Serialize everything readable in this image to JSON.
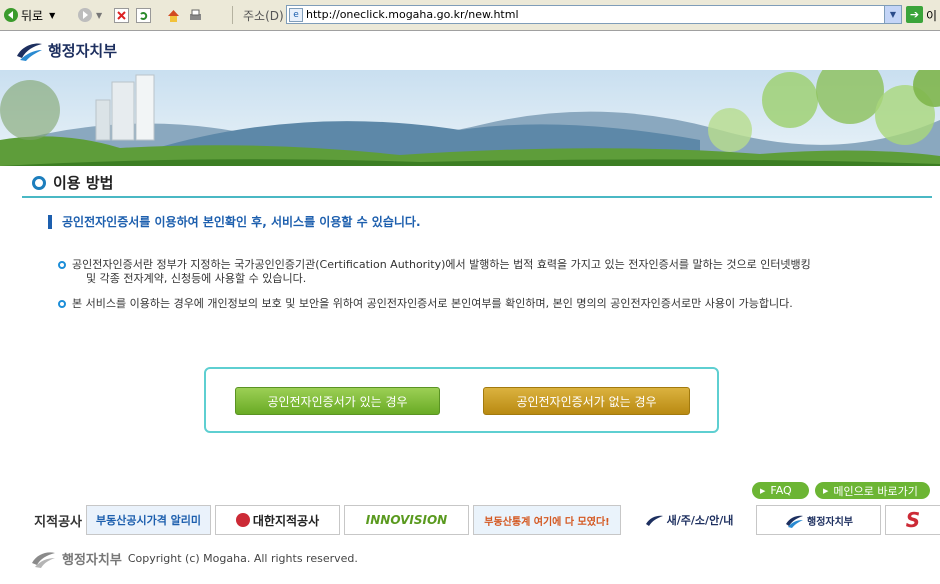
{
  "browser": {
    "back_label": "뒤로",
    "address_label": "주소(D)",
    "url": "http://oneclick.mogaha.go.kr/new.html",
    "go_label": "이"
  },
  "logo": {
    "text": "행정자치부"
  },
  "section": {
    "title": "이용 방법"
  },
  "headline": "공인전자인증서를 이용하여 본인확인 후, 서비스를 이용할 수 있습니다.",
  "bullets": [
    {
      "line1": "공인전자인증서란 정부가 지정하는 국가공인인증기관(Certification Authority)에서 발행하는 법적 효력을 가지고 있는 전자인증서를 말하는 것으로 인터넷뱅킹",
      "line2": "및 각종 전자계약, 신청등에 사용할 수 있습니다."
    },
    {
      "line1": "본 서비스를 이용하는 경우에 개인정보의 보호 및 보안을 위하여 공인전자인증서로 본인여부를 확인하며, 본인 명의의 공인전자인증서로만 사용이 가능합니다.",
      "line2": ""
    }
  ],
  "buttons": {
    "with_cert": "공인전자인증서가 있는 경우",
    "without_cert": "공인전자인증서가 없는 경우"
  },
  "links": {
    "faq": "FAQ",
    "main": "메인으로 바로가기"
  },
  "partners": [
    {
      "name": "지적공사",
      "color": "#333333"
    },
    {
      "name": "부동산공시가격 알리미",
      "color": "#1d5fae"
    },
    {
      "name": "대한지적공사",
      "color": "#222222"
    },
    {
      "name": "INNOVISION",
      "color": "#5a9a1f"
    },
    {
      "name": "부동산통계 여기에 다 모였다!",
      "color": "#d4571f"
    },
    {
      "name": "새/주/소/안/내",
      "color": "#1d2f5f"
    },
    {
      "name": "행정자치부",
      "color": "#1d2f5f"
    },
    {
      "name": "S",
      "color": "#cc2a36"
    }
  ],
  "footer": {
    "logo_text": "행정자치부",
    "copyright": "Copyright (c) Mogaha. All rights reserved."
  },
  "colors": {
    "accent": "#4ab8c4",
    "headline": "#1d5fae",
    "green_button": "#6cb534",
    "gold_button": "#c9a020"
  }
}
